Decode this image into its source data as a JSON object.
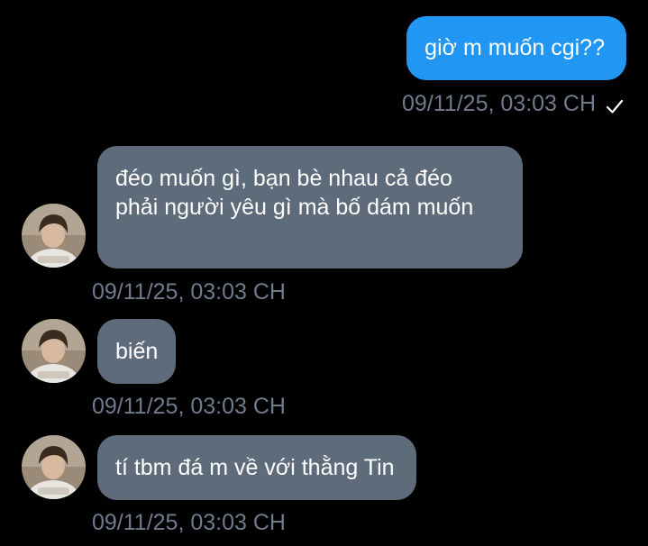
{
  "messages": [
    {
      "direction": "outgoing",
      "text": "giờ m muốn cgi??",
      "timestamp": "09/11/25, 03:03 CH",
      "status_icon": "check-icon"
    },
    {
      "direction": "incoming",
      "text": "đéo muốn gì, bạn bè nhau cả đéo phải người yêu gì mà bố dám muốn",
      "timestamp": "09/11/25, 03:03 CH"
    },
    {
      "direction": "incoming",
      "text": "biến",
      "timestamp": "09/11/25, 03:03 CH"
    },
    {
      "direction": "incoming",
      "text": "tí tbm đá m về với thằng Tin",
      "timestamp": "09/11/25, 03:03 CH"
    }
  ],
  "colors": {
    "background": "#000000",
    "outgoing_bubble": "#2196f3",
    "incoming_bubble": "#5e6b7b",
    "timestamp": "#6f7b8c",
    "text": "#ffffff"
  }
}
